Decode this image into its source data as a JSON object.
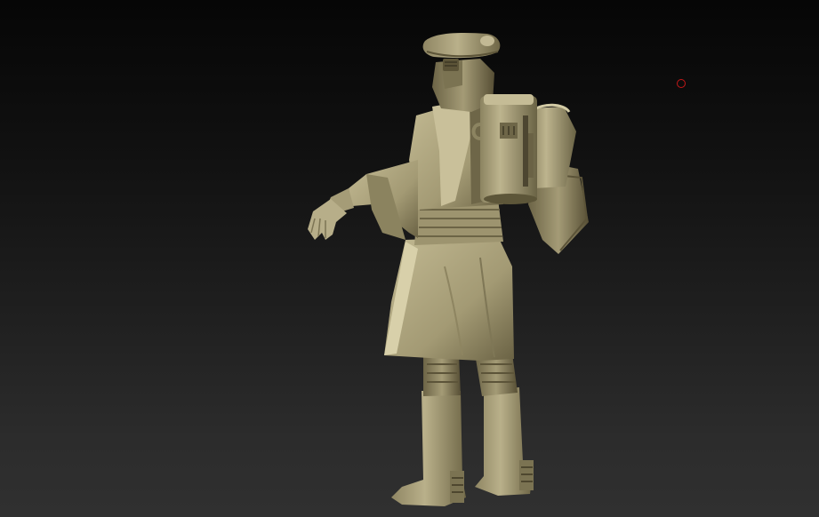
{
  "viewport": {
    "background_top": "#060606",
    "background_bottom": "#303030"
  },
  "model": {
    "material_color": "#b5ab86",
    "shadow_color": "#5a5237",
    "highlight_color": "#d9d1ac"
  },
  "cursor": {
    "color": "#c41818",
    "icon": "brush-cursor-ring-icon"
  }
}
